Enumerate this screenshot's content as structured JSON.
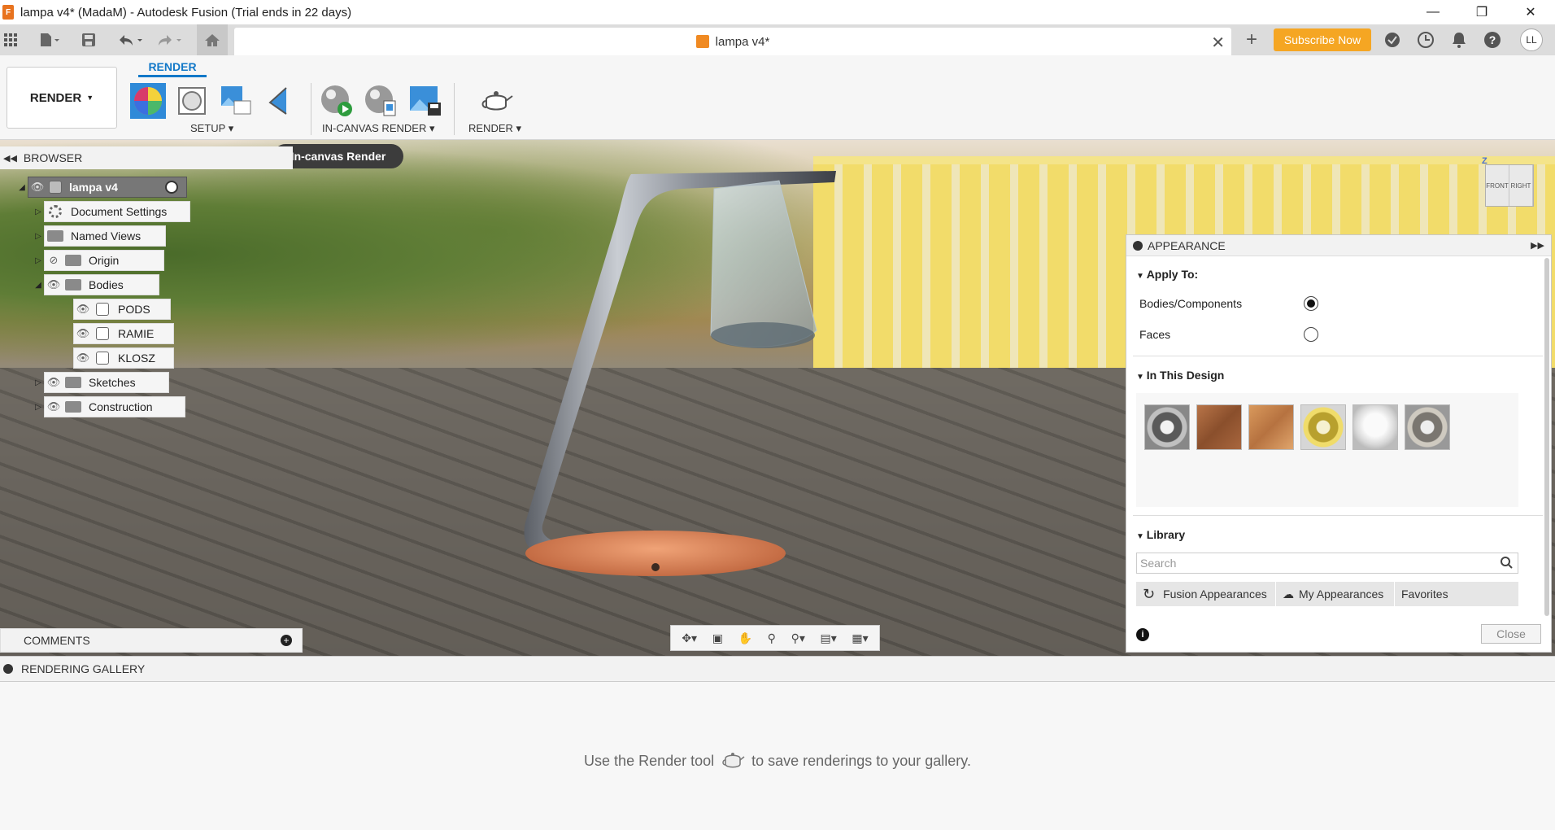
{
  "window": {
    "title": "lampa v4* (MadaM) - Autodesk Fusion (Trial ends in 22 days)",
    "app_letter": "F"
  },
  "tabs": {
    "document_tab": "lampa v4*",
    "subscribe": "Subscribe Now",
    "avatar": "LL"
  },
  "toolbar": {
    "workspace": "RENDER",
    "active_tab": "RENDER",
    "groups": {
      "setup": "SETUP",
      "in_canvas_render": "IN-CANVAS RENDER",
      "render": "RENDER"
    },
    "tooltip": "In-canvas Render"
  },
  "browser": {
    "title": "BROWSER",
    "root": "lampa v4",
    "items": [
      {
        "label": "Document Settings"
      },
      {
        "label": "Named Views"
      },
      {
        "label": "Origin"
      },
      {
        "label": "Bodies"
      },
      {
        "label": "PODS"
      },
      {
        "label": "RAMIE"
      },
      {
        "label": "KLOSZ"
      },
      {
        "label": "Sketches"
      },
      {
        "label": "Construction"
      }
    ]
  },
  "comments": {
    "title": "COMMENTS"
  },
  "viewcube": {
    "front": "FRONT",
    "right": "RIGHT",
    "axis": "Z"
  },
  "appearance": {
    "title": "APPEARANCE",
    "apply_to": "Apply To:",
    "option_bodies": "Bodies/Components",
    "option_faces": "Faces",
    "in_this_design": "In This Design",
    "library": "Library",
    "search_placeholder": "Search",
    "lib_tabs": [
      "Fusion Appearances",
      "My Appearances",
      "Favorites"
    ],
    "close": "Close",
    "selected": "Bodies/Components"
  },
  "gallery": {
    "title": "RENDERING GALLERY",
    "msg_before": "Use the Render tool",
    "msg_after": "to save renderings to your gallery."
  }
}
